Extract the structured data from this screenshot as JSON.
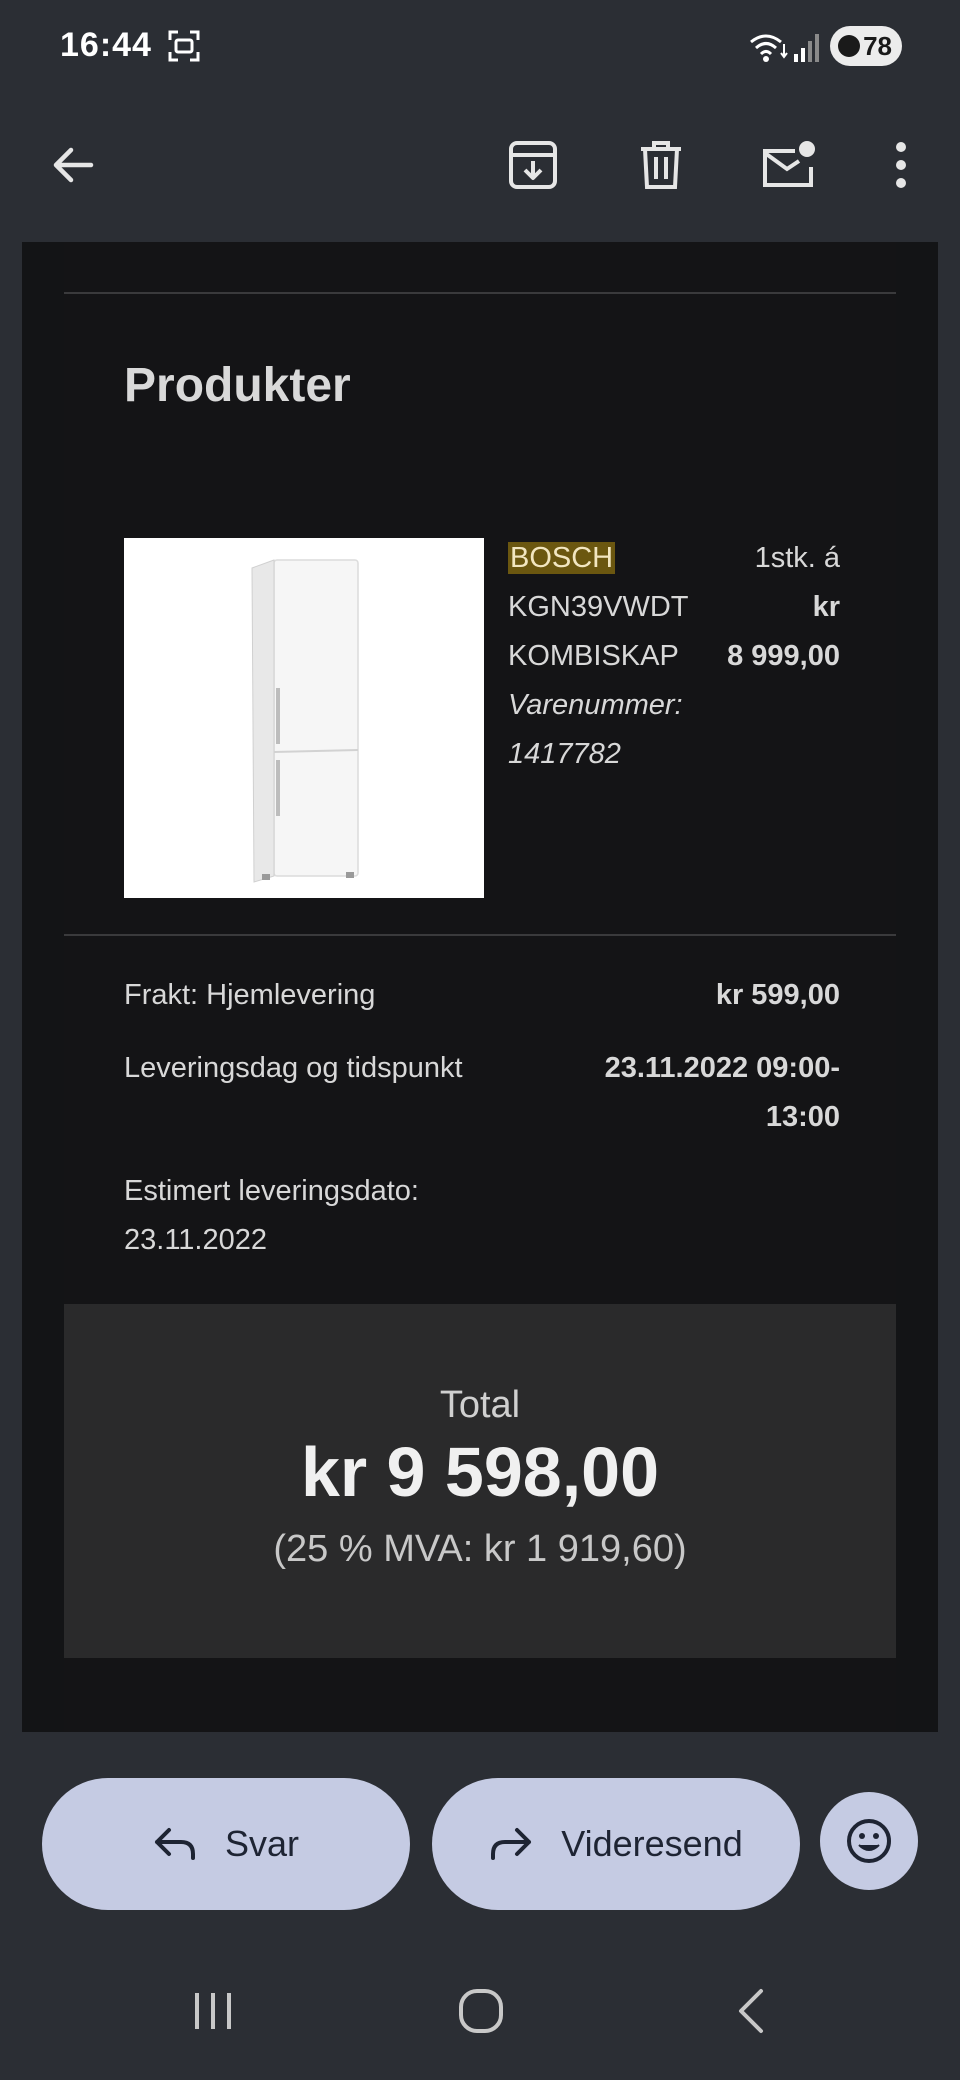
{
  "status_bar": {
    "time": "16:44",
    "battery_level": "78"
  },
  "toolbar": {
    "icons": [
      "back-arrow-icon",
      "archive-icon",
      "delete-icon",
      "mark-unread-icon",
      "more-vert-icon"
    ]
  },
  "email": {
    "section_title": "Produkter",
    "product": {
      "brand": "BOSCH",
      "model": "KGN39VWDT",
      "type": "KOMBISKAP",
      "item_number_label": "Varenummer:",
      "item_number": "1417782",
      "quantity_text": "1stk. á",
      "currency": "kr",
      "price": "8 999,00"
    },
    "shipping_label": "Frakt: Hjemlevering",
    "shipping_price": "kr 599,00",
    "delivery_slot_label": "Leveringsdag og tidspunkt",
    "delivery_slot_line1": "23.11.2022 09:00-",
    "delivery_slot_line2": "13:00",
    "estimated_label": "Estimert leveringsdato:",
    "estimated_date": "23.11.2022",
    "total_label": "Total",
    "total_amount": "kr 9 598,00",
    "vat_text": "(25 % MVA: kr 1 919,60)"
  },
  "actions": {
    "reply_label": "Svar",
    "forward_label": "Videresend",
    "reply_icon": "reply-icon",
    "forward_icon": "forward-icon",
    "emoji_icon": "emoji-icon"
  },
  "colors": {
    "background": "#2b2e34",
    "email_background": "#141416",
    "pill": "#c5cbe3",
    "highlight": "#6b5710"
  }
}
